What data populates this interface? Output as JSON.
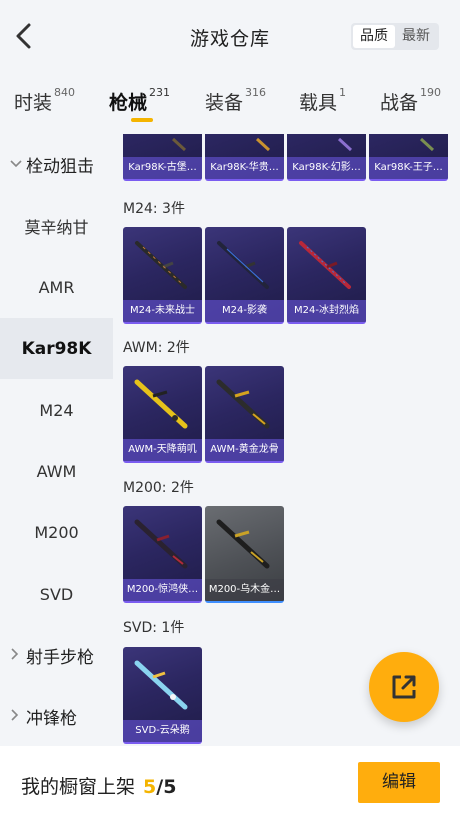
{
  "header": {
    "title": "游戏仓库",
    "sort_options": [
      "品质",
      "最新"
    ],
    "sort_selected": "品质"
  },
  "tabs": [
    {
      "label": "时装",
      "count": "840"
    },
    {
      "label": "枪械",
      "count": "231"
    },
    {
      "label": "装备",
      "count": "316"
    },
    {
      "label": "载具",
      "count": "1"
    },
    {
      "label": "战备",
      "count": "190"
    }
  ],
  "active_tab": "枪械",
  "sidebar": {
    "items": [
      {
        "label": "栓动狙击",
        "type": "group",
        "expanded": true
      },
      {
        "label": "莫辛纳甘",
        "type": "item"
      },
      {
        "label": "AMR",
        "type": "item"
      },
      {
        "label": "Kar98K",
        "type": "item",
        "selected": true
      },
      {
        "label": "M24",
        "type": "item"
      },
      {
        "label": "AWM",
        "type": "item"
      },
      {
        "label": "M200",
        "type": "item"
      },
      {
        "label": "SVD",
        "type": "item"
      },
      {
        "label": "射手步枪",
        "type": "group",
        "expanded": false
      },
      {
        "label": "冲锋枪",
        "type": "group",
        "expanded": false
      }
    ]
  },
  "sections": {
    "kar98k": {
      "items": [
        "Kar98K-古堡…",
        "Kar98K-华贵…",
        "Kar98K-幻影…",
        "Kar98K-王子…"
      ]
    },
    "m24": {
      "label": "M24: 3件",
      "items": [
        "M24-未来战士",
        "M24-影袭",
        "M24-冰封烈焰"
      ]
    },
    "awm": {
      "label": "AWM: 2件",
      "items": [
        "AWM-天降萌叽",
        "AWM-黄金龙骨"
      ]
    },
    "m200": {
      "label": "M200: 2件",
      "items": [
        "M200-惊鸿侠…",
        "M200-乌木金…"
      ]
    },
    "svd": {
      "label": "SVD: 1件",
      "items": [
        "SVD-云朵鹅"
      ]
    }
  },
  "showcase": {
    "label": "我的橱窗上架",
    "current": "5",
    "total": "/5"
  },
  "edit_button": "编辑",
  "icons": {
    "back": "back-arrow-icon",
    "fab": "share-external-icon"
  },
  "colors": {
    "accent": "#ffad0d",
    "card_purple": "#2b2660",
    "highlight": "#f4b400"
  }
}
